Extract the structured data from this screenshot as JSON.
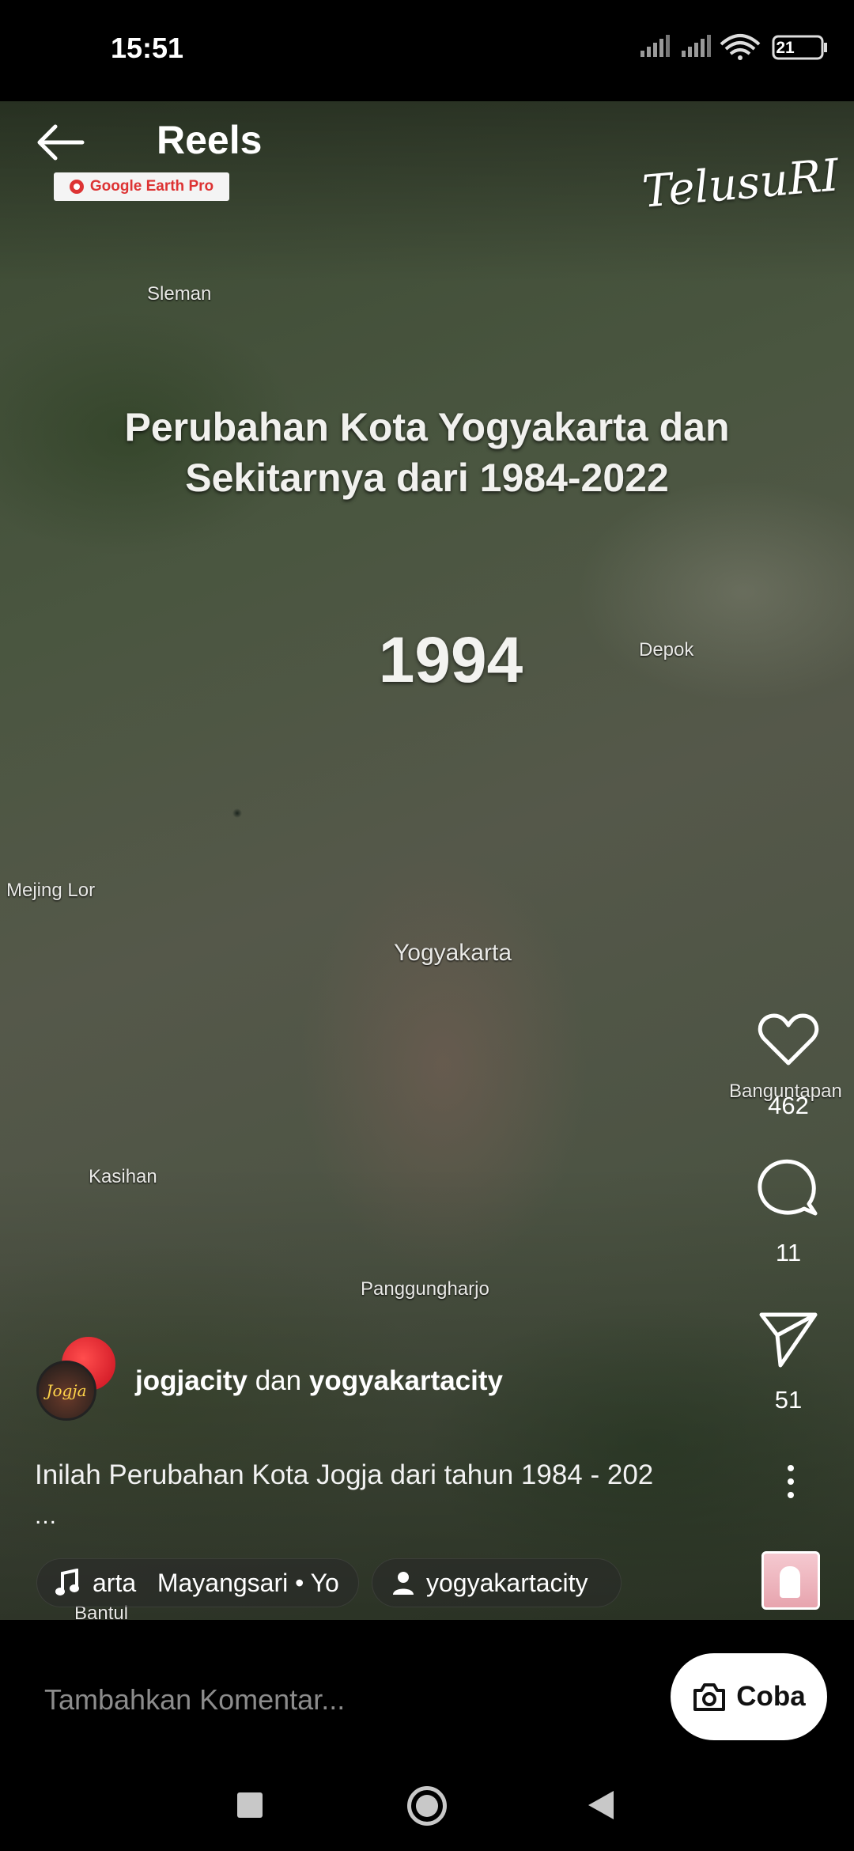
{
  "status_bar": {
    "time": "15:51",
    "battery": "21"
  },
  "header": {
    "title": "Reels",
    "back_icon": "arrow-left-icon"
  },
  "video": {
    "badge": "Google Earth Pro",
    "watermark": "TelusuRI",
    "title_line1": "Perubahan Kota Yogyakarta dan",
    "title_line2": "Sekitarnya dari 1984-2022",
    "year": "1994",
    "map_labels": {
      "sleman": "Sleman",
      "depok": "Depok",
      "mejing": "Mejing Lor",
      "yogyakarta": "Yogyakarta",
      "banguntapan": "Banguntapan",
      "kasihan": "Kasihan",
      "panggungharjo": "Panggungharjo",
      "bantul": "Bantul"
    }
  },
  "actions": {
    "like_count": "462",
    "comment_count": "11",
    "share_count": "51"
  },
  "post": {
    "author1": "jogjacity",
    "connector": "dan",
    "author2": "yogyakartacity",
    "avatar_text": "Jogja",
    "caption": "Inilah Perubahan Kota Jogja dari tahun 1984 - 202",
    "caption_more": "...",
    "audio_label": "arta   Mayangsari • Yo",
    "tagged_user": "yogyakartacity"
  },
  "comment_bar": {
    "placeholder": "Tambahkan Komentar...",
    "try_label": "Coba"
  },
  "colors": {
    "background": "#000000",
    "accent_red": "#dd3333",
    "text": "#ffffff"
  }
}
